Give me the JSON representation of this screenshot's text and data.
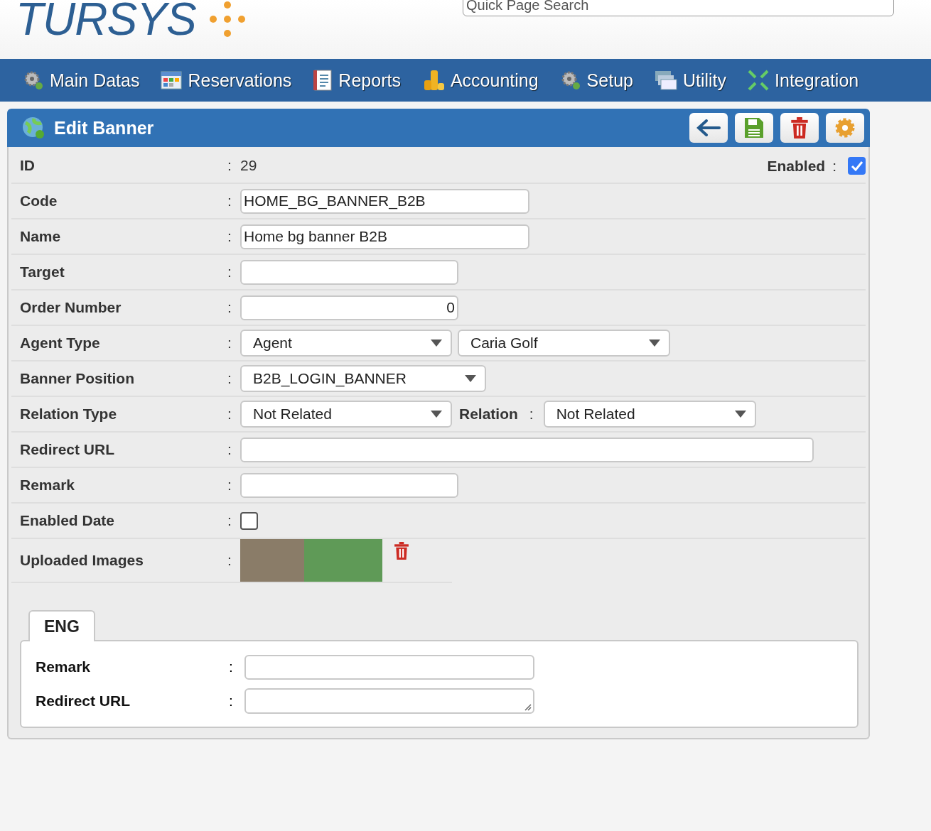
{
  "logo": {
    "text": "TURSYS"
  },
  "search": {
    "placeholder": "Quick Page Search"
  },
  "nav": [
    {
      "label": "Main Datas"
    },
    {
      "label": "Reservations"
    },
    {
      "label": "Reports"
    },
    {
      "label": "Accounting"
    },
    {
      "label": "Setup"
    },
    {
      "label": "Utility"
    },
    {
      "label": "Integration"
    }
  ],
  "panel": {
    "title": "Edit Banner",
    "enabled": {
      "label": "Enabled",
      "sep": ":",
      "checked": true
    },
    "fields": [
      {
        "kind": "text",
        "label": "ID",
        "sep": ":",
        "value": "29"
      },
      {
        "kind": "input",
        "label": "Code",
        "sep": ":",
        "value": "HOME_BG_BANNER_B2B"
      },
      {
        "kind": "input",
        "label": "Name",
        "sep": ":",
        "value": "Home bg banner B2B"
      },
      {
        "kind": "input",
        "label": "Target",
        "sep": ":"
      },
      {
        "kind": "number",
        "label": "Order Number",
        "sep": ":",
        "value": "0"
      },
      {
        "kind": "select",
        "label": "Agent Type",
        "sep": ":",
        "selects": [
          {
            "value": "Agent"
          },
          {
            "value": "Caria Golf"
          }
        ]
      },
      {
        "kind": "select",
        "label": "Banner Position",
        "sep": ":",
        "selects": [
          {
            "value": "B2B_LOGIN_BANNER"
          }
        ]
      },
      {
        "kind": "select",
        "label": "Relation Type",
        "sep": ":",
        "selects": [
          {
            "value": "Not Related"
          },
          {
            "label": "Relation",
            "sep": ":",
            "value": "Not Related"
          }
        ]
      },
      {
        "kind": "input",
        "label": "Redirect URL",
        "sep": ":"
      },
      {
        "kind": "input",
        "label": "Remark",
        "sep": ":"
      },
      {
        "kind": "checkbox",
        "label": "Enabled Date",
        "sep": ":",
        "checked": false
      },
      {
        "kind": "image",
        "label": "Uploaded Images",
        "sep": ":"
      }
    ],
    "tabs": [
      {
        "label": "ENG",
        "selected": true
      }
    ],
    "tab_fields": [
      {
        "kind": "input",
        "label": "Remark",
        "sep": ":"
      },
      {
        "kind": "textarea",
        "label": "Redirect URL",
        "sep": ":"
      }
    ]
  }
}
